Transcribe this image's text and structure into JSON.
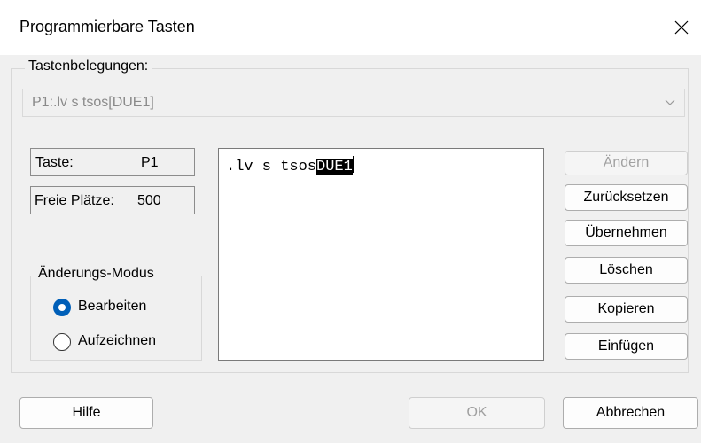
{
  "window": {
    "title": "Programmierbare Tasten"
  },
  "key_assignments": {
    "legend": "Tastenbelegungen:",
    "selected": "P1:.lv s tsos[DUE1]"
  },
  "key_info": {
    "key_label": "Taste:",
    "key_value": "P1",
    "free_label": "Freie Plätze:",
    "free_value": "500"
  },
  "mode": {
    "legend": "Änderungs-Modus",
    "options": [
      {
        "label": "Bearbeiten",
        "selected": true
      },
      {
        "label": "Aufzeichnen",
        "selected": false
      }
    ]
  },
  "editor": {
    "text": ".lv s tsos",
    "selected_text": "DUE1"
  },
  "side_buttons": {
    "change": "Ändern",
    "reset": "Zurücksetzen",
    "apply": "Übernehmen",
    "delete": "Löschen",
    "copy": "Kopieren",
    "paste": "Einfügen"
  },
  "footer": {
    "help": "Hilfe",
    "ok": "OK",
    "cancel": "Abbrechen"
  },
  "colors": {
    "accent": "#005fb8",
    "window_bg": "#f0f0f0",
    "selection_bg": "#000000"
  },
  "icons": {
    "close": "close-icon",
    "dropdown": "chevron-down-icon"
  }
}
